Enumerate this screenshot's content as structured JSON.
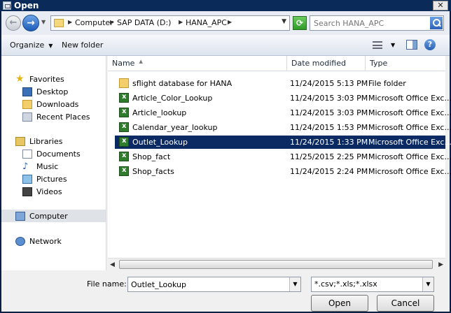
{
  "window": {
    "title": "Open"
  },
  "address": {
    "crumbs": [
      "Computer",
      "SAP DATA (D:)",
      "HANA_APC"
    ],
    "search_placeholder": "Search HANA_APC"
  },
  "toolbar": {
    "organize": "Organize",
    "new_folder": "New folder"
  },
  "nav": {
    "favorites": "Favorites",
    "desktop": "Desktop",
    "downloads": "Downloads",
    "recent": "Recent Places",
    "libraries": "Libraries",
    "documents": "Documents",
    "music": "Music",
    "pictures": "Pictures",
    "videos": "Videos",
    "computer": "Computer",
    "network": "Network"
  },
  "columns": {
    "name": "Name",
    "date": "Date modified",
    "type": "Type"
  },
  "files": [
    {
      "name": "sflight database for HANA",
      "date": "11/24/2015 5:13 PM",
      "type": "File folder",
      "icon": "folder-icon"
    },
    {
      "name": "Article_Color_Lookup",
      "date": "11/24/2015 3:03 PM",
      "type": "Microsoft Office Exc...",
      "icon": "excel-icon"
    },
    {
      "name": "Article_lookup",
      "date": "11/24/2015 3:03 PM",
      "type": "Microsoft Office Exc...",
      "icon": "excel-icon"
    },
    {
      "name": "Calendar_year_lookup",
      "date": "11/24/2015 1:53 PM",
      "type": "Microsoft Office Exc...",
      "icon": "excel-icon"
    },
    {
      "name": "Outlet_Lookup",
      "date": "11/24/2015 1:33 PM",
      "type": "Microsoft Office Exc...",
      "icon": "excel-icon",
      "selected": true
    },
    {
      "name": "Shop_fact",
      "date": "11/25/2015 2:25 PM",
      "type": "Microsoft Office Exc...",
      "icon": "excel-icon"
    },
    {
      "name": "Shop_facts",
      "date": "11/24/2015 2:24 PM",
      "type": "Microsoft Office Exc...",
      "icon": "excel-icon"
    }
  ],
  "bottom": {
    "filename_label": "File name:",
    "filename_value": "Outlet_Lookup",
    "filetype": "*.csv;*.xls;*.xlsx",
    "open_label": "Open",
    "cancel_label": "Cancel"
  }
}
